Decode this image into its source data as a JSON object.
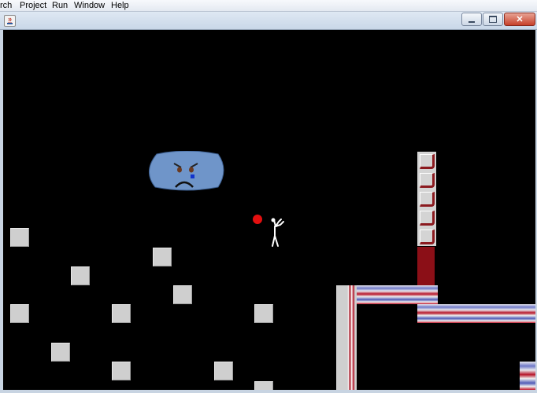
{
  "menu": {
    "items": [
      "rch",
      "Project",
      "Run",
      "Window",
      "Help"
    ]
  },
  "window": {
    "icon": "java-app-icon",
    "buttons": [
      "minimize",
      "maximize",
      "close"
    ]
  },
  "game": {
    "background_color": "#000000",
    "block_color": "#cfcfcf",
    "pipe_red": "#b8162a",
    "pipe_blue": "#5a66c0",
    "enemy": {
      "type": "sad-cloud",
      "color": "#6f95c9"
    },
    "projectile": {
      "color": "#e30f0f"
    },
    "player": {
      "type": "stick-figure",
      "color": "#ffffff"
    }
  }
}
